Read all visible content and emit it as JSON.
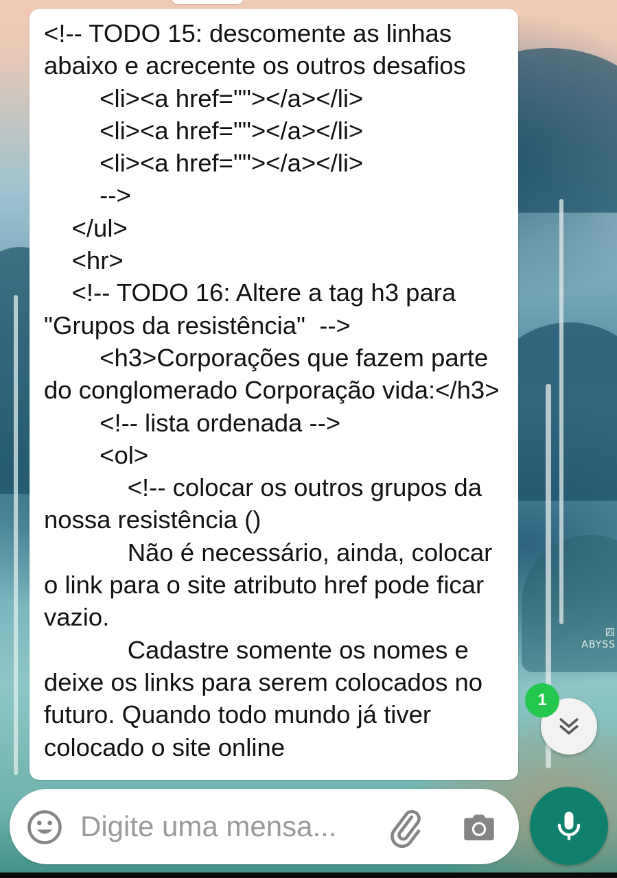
{
  "chat": {
    "message_text": "<!-- TODO 15: descomente as linhas abaixo e acrecente os outros desafios\n        <li><a href=\"\"></a></li>\n        <li><a href=\"\"></a></li>\n        <li><a href=\"\"></a></li>\n        -->\n    </ul>\n    <hr>\n    <!-- TODO 16: Altere a tag h3 para \"Grupos da resistência\"  -->\n        <h3>Corporações que fazem parte do conglomerado Corporação vida:</h3>\n        <!-- lista ordenada -->\n        <ol>\n            <!-- colocar os outros grupos da nossa resistência ()\n            Não é necessário, ainda, colocar o link para o site atributo href pode ficar vazio.\n            Cadastre somente os nomes e deixe os links para serem colocados no futuro. Quando todo mundo já tiver colocado o site online",
    "unread_count": "1"
  },
  "wallpaper": {
    "sign_text": "四\nABYSS"
  },
  "composer": {
    "placeholder": "Digite uma mensa...",
    "value": ""
  },
  "icons": {
    "emoji": "emoji-icon",
    "attach": "paperclip-icon",
    "camera": "camera-icon",
    "mic": "microphone-icon",
    "scroll_down": "double-chevron-down-icon"
  },
  "colors": {
    "mic_button": "#10806e",
    "unread_badge": "#25c84f",
    "bubble": "#ffffff"
  }
}
